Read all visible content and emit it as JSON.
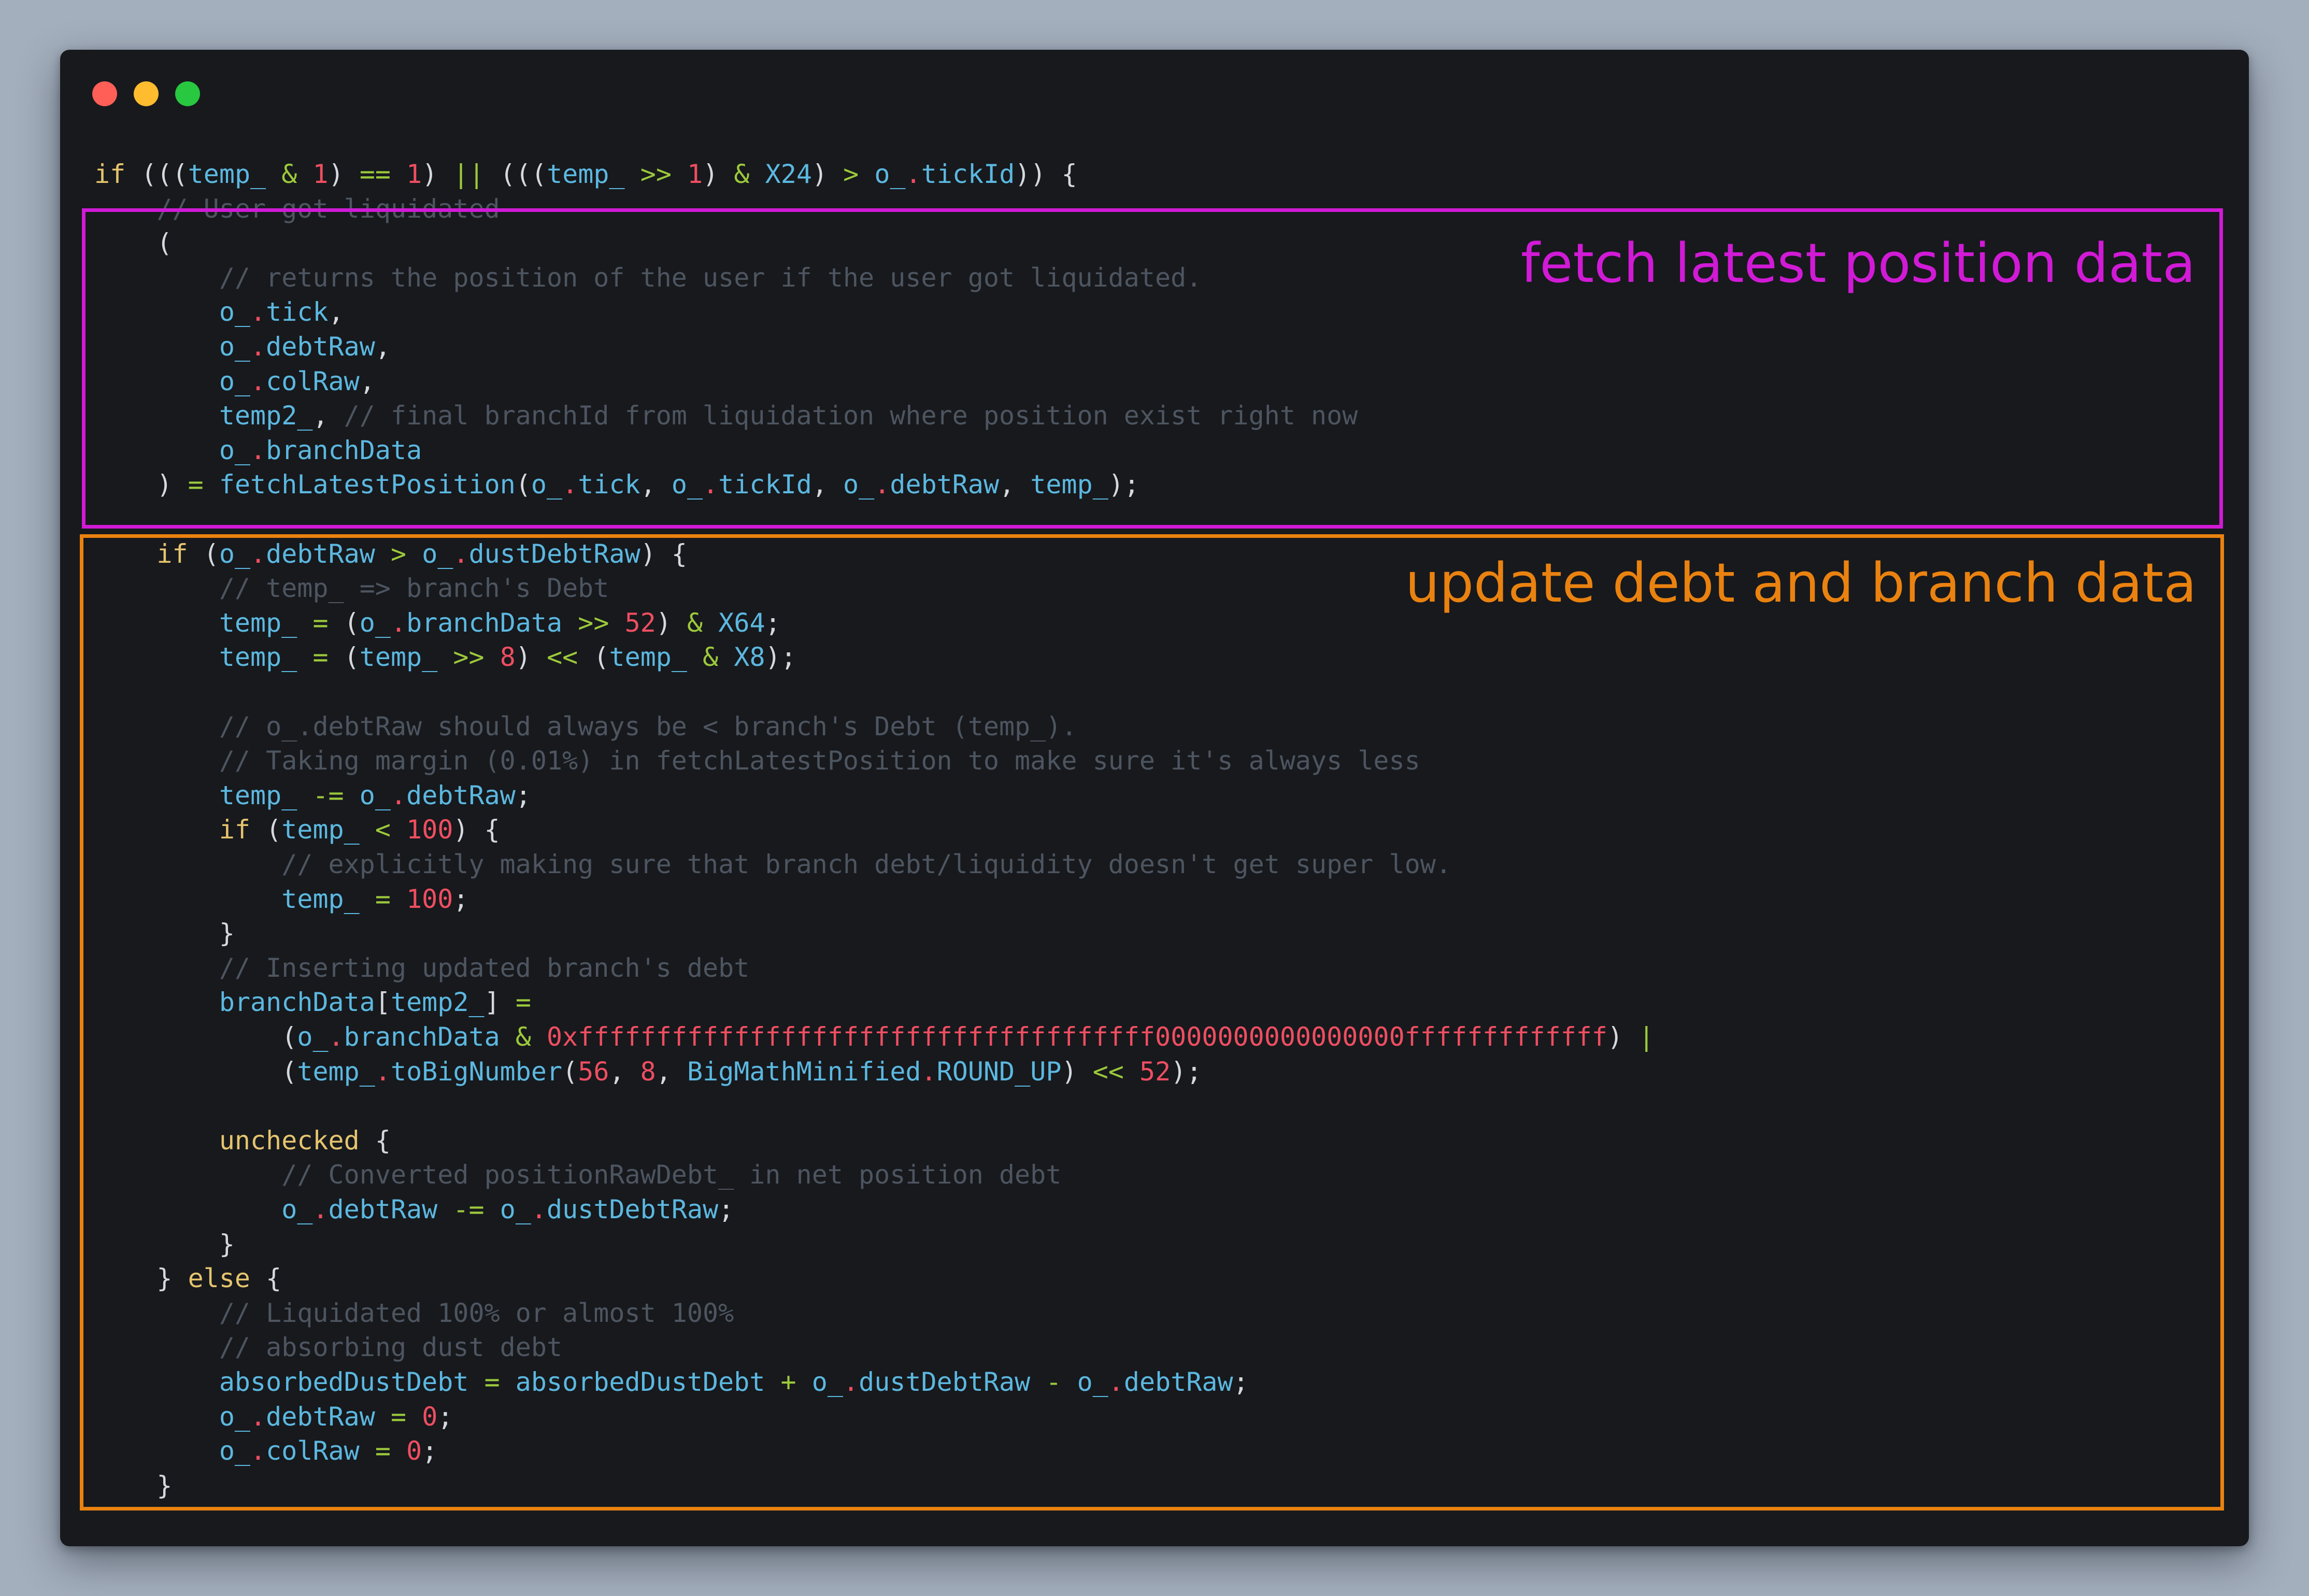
{
  "window": {
    "controls": {
      "close": "close-dot",
      "minimize": "minimize-dot",
      "zoom": "zoom-dot"
    }
  },
  "annotations": [
    {
      "label": "fetch latest position data",
      "color": "#d11ad6"
    },
    {
      "label": "update debt and branch data",
      "color": "#ea8210"
    }
  ],
  "colors": {
    "background": "#a4afbd",
    "editor": "#17191d",
    "keyword": "#e5c46e",
    "identifier": "#5cb8e0",
    "operator": "#9cc93b",
    "number": "#ef4e61",
    "comment": "#4d5560",
    "plain": "#d5d8dd"
  },
  "code": [
    [
      [
        "kw",
        "if"
      ],
      [
        "pl",
        " ((("
      ],
      [
        "id",
        "temp_"
      ],
      [
        "pl",
        " "
      ],
      [
        "op",
        "&"
      ],
      [
        "pl",
        " "
      ],
      [
        "num",
        "1"
      ],
      [
        "pl",
        ") "
      ],
      [
        "op",
        "=="
      ],
      [
        "pl",
        " "
      ],
      [
        "num",
        "1"
      ],
      [
        "pl",
        ") "
      ],
      [
        "op",
        "||"
      ],
      [
        "pl",
        " ((("
      ],
      [
        "id",
        "temp_"
      ],
      [
        "pl",
        " "
      ],
      [
        "op",
        ">>"
      ],
      [
        "pl",
        " "
      ],
      [
        "num",
        "1"
      ],
      [
        "pl",
        ") "
      ],
      [
        "op",
        "&"
      ],
      [
        "pl",
        " "
      ],
      [
        "id",
        "X24"
      ],
      [
        "pl",
        ") "
      ],
      [
        "op",
        ">"
      ],
      [
        "pl",
        " "
      ],
      [
        "id",
        "o_"
      ],
      [
        "dot",
        "."
      ],
      [
        "id",
        "tickId"
      ],
      [
        "pl",
        ")) {"
      ]
    ],
    [
      [
        "pl",
        "    "
      ],
      [
        "st",
        "// User got liquidated"
      ]
    ],
    [
      [
        "pl",
        "    ("
      ]
    ],
    [
      [
        "pl",
        "        "
      ],
      [
        "cm",
        "// returns the position of the user if the user got liquidated."
      ]
    ],
    [
      [
        "pl",
        "        "
      ],
      [
        "id",
        "o_"
      ],
      [
        "dot",
        "."
      ],
      [
        "id",
        "tick"
      ],
      [
        "pl",
        ","
      ]
    ],
    [
      [
        "pl",
        "        "
      ],
      [
        "id",
        "o_"
      ],
      [
        "dot",
        "."
      ],
      [
        "id",
        "debtRaw"
      ],
      [
        "pl",
        ","
      ]
    ],
    [
      [
        "pl",
        "        "
      ],
      [
        "id",
        "o_"
      ],
      [
        "dot",
        "."
      ],
      [
        "id",
        "colRaw"
      ],
      [
        "pl",
        ","
      ]
    ],
    [
      [
        "pl",
        "        "
      ],
      [
        "id",
        "temp2_"
      ],
      [
        "pl",
        ", "
      ],
      [
        "cm",
        "// final branchId from liquidation where position exist right now"
      ]
    ],
    [
      [
        "pl",
        "        "
      ],
      [
        "id",
        "o_"
      ],
      [
        "dot",
        "."
      ],
      [
        "id",
        "branchData"
      ]
    ],
    [
      [
        "pl",
        "    ) "
      ],
      [
        "op",
        "="
      ],
      [
        "pl",
        " "
      ],
      [
        "id",
        "fetchLatestPosition"
      ],
      [
        "pl",
        "("
      ],
      [
        "id",
        "o_"
      ],
      [
        "dot",
        "."
      ],
      [
        "id",
        "tick"
      ],
      [
        "pl",
        ", "
      ],
      [
        "id",
        "o_"
      ],
      [
        "dot",
        "."
      ],
      [
        "id",
        "tickId"
      ],
      [
        "pl",
        ", "
      ],
      [
        "id",
        "o_"
      ],
      [
        "dot",
        "."
      ],
      [
        "id",
        "debtRaw"
      ],
      [
        "pl",
        ", "
      ],
      [
        "id",
        "temp_"
      ],
      [
        "pl",
        ");"
      ]
    ],
    [
      [
        "pl",
        ""
      ]
    ],
    [
      [
        "pl",
        "    "
      ],
      [
        "kw",
        "if"
      ],
      [
        "pl",
        " ("
      ],
      [
        "id",
        "o_"
      ],
      [
        "dot",
        "."
      ],
      [
        "id",
        "debtRaw"
      ],
      [
        "pl",
        " "
      ],
      [
        "op",
        ">"
      ],
      [
        "pl",
        " "
      ],
      [
        "id",
        "o_"
      ],
      [
        "dot",
        "."
      ],
      [
        "id",
        "dustDebtRaw"
      ],
      [
        "pl",
        ") {"
      ]
    ],
    [
      [
        "pl",
        "        "
      ],
      [
        "cm",
        "// temp_ => branch's Debt"
      ]
    ],
    [
      [
        "pl",
        "        "
      ],
      [
        "id",
        "temp_"
      ],
      [
        "pl",
        " "
      ],
      [
        "op",
        "="
      ],
      [
        "pl",
        " ("
      ],
      [
        "id",
        "o_"
      ],
      [
        "dot",
        "."
      ],
      [
        "id",
        "branchData"
      ],
      [
        "pl",
        " "
      ],
      [
        "op",
        ">>"
      ],
      [
        "pl",
        " "
      ],
      [
        "num",
        "52"
      ],
      [
        "pl",
        ") "
      ],
      [
        "op",
        "&"
      ],
      [
        "pl",
        " "
      ],
      [
        "id",
        "X64"
      ],
      [
        "pl",
        ";"
      ]
    ],
    [
      [
        "pl",
        "        "
      ],
      [
        "id",
        "temp_"
      ],
      [
        "pl",
        " "
      ],
      [
        "op",
        "="
      ],
      [
        "pl",
        " ("
      ],
      [
        "id",
        "temp_"
      ],
      [
        "pl",
        " "
      ],
      [
        "op",
        ">>"
      ],
      [
        "pl",
        " "
      ],
      [
        "num",
        "8"
      ],
      [
        "pl",
        ") "
      ],
      [
        "op",
        "<<"
      ],
      [
        "pl",
        " ("
      ],
      [
        "id",
        "temp_"
      ],
      [
        "pl",
        " "
      ],
      [
        "op",
        "&"
      ],
      [
        "pl",
        " "
      ],
      [
        "id",
        "X8"
      ],
      [
        "pl",
        ");"
      ]
    ],
    [
      [
        "pl",
        ""
      ]
    ],
    [
      [
        "pl",
        "        "
      ],
      [
        "cm",
        "// o_.debtRaw should always be < branch's Debt (temp_)."
      ]
    ],
    [
      [
        "pl",
        "        "
      ],
      [
        "cm",
        "// Taking margin (0.01%) in fetchLatestPosition to make sure it's always less"
      ]
    ],
    [
      [
        "pl",
        "        "
      ],
      [
        "id",
        "temp_"
      ],
      [
        "pl",
        " "
      ],
      [
        "op",
        "-="
      ],
      [
        "pl",
        " "
      ],
      [
        "id",
        "o_"
      ],
      [
        "dot",
        "."
      ],
      [
        "id",
        "debtRaw"
      ],
      [
        "pl",
        ";"
      ]
    ],
    [
      [
        "pl",
        "        "
      ],
      [
        "kw",
        "if"
      ],
      [
        "pl",
        " ("
      ],
      [
        "id",
        "temp_"
      ],
      [
        "pl",
        " "
      ],
      [
        "op",
        "<"
      ],
      [
        "pl",
        " "
      ],
      [
        "num",
        "100"
      ],
      [
        "pl",
        ") {"
      ]
    ],
    [
      [
        "pl",
        "            "
      ],
      [
        "cm",
        "// explicitly making sure that branch debt/liquidity doesn't get super low."
      ]
    ],
    [
      [
        "pl",
        "            "
      ],
      [
        "id",
        "temp_"
      ],
      [
        "pl",
        " "
      ],
      [
        "op",
        "="
      ],
      [
        "pl",
        " "
      ],
      [
        "num",
        "100"
      ],
      [
        "pl",
        ";"
      ]
    ],
    [
      [
        "pl",
        "        }"
      ]
    ],
    [
      [
        "pl",
        "        "
      ],
      [
        "cm",
        "// Inserting updated branch's debt"
      ]
    ],
    [
      [
        "pl",
        "        "
      ],
      [
        "id",
        "branchData"
      ],
      [
        "pl",
        "["
      ],
      [
        "id",
        "temp2_"
      ],
      [
        "pl",
        "] "
      ],
      [
        "op",
        "="
      ]
    ],
    [
      [
        "pl",
        "            ("
      ],
      [
        "id",
        "o_"
      ],
      [
        "dot",
        "."
      ],
      [
        "id",
        "branchData"
      ],
      [
        "pl",
        " "
      ],
      [
        "op",
        "&"
      ],
      [
        "pl",
        " "
      ],
      [
        "num",
        "0xfffffffffffffffffffffffffffffffffffff0000000000000000fffffffffffff"
      ],
      [
        "pl",
        ") "
      ],
      [
        "op",
        "|"
      ]
    ],
    [
      [
        "pl",
        "            ("
      ],
      [
        "id",
        "temp_"
      ],
      [
        "dot",
        "."
      ],
      [
        "id",
        "toBigNumber"
      ],
      [
        "pl",
        "("
      ],
      [
        "num",
        "56"
      ],
      [
        "pl",
        ", "
      ],
      [
        "num",
        "8"
      ],
      [
        "pl",
        ", "
      ],
      [
        "id",
        "BigMathMinified"
      ],
      [
        "dot",
        "."
      ],
      [
        "id",
        "ROUND_UP"
      ],
      [
        "pl",
        ") "
      ],
      [
        "op",
        "<<"
      ],
      [
        "pl",
        " "
      ],
      [
        "num",
        "52"
      ],
      [
        "pl",
        ");"
      ]
    ],
    [
      [
        "pl",
        ""
      ]
    ],
    [
      [
        "pl",
        "        "
      ],
      [
        "kw",
        "unchecked"
      ],
      [
        "pl",
        " {"
      ]
    ],
    [
      [
        "pl",
        "            "
      ],
      [
        "cm",
        "// Converted positionRawDebt_ in net position debt"
      ]
    ],
    [
      [
        "pl",
        "            "
      ],
      [
        "id",
        "o_"
      ],
      [
        "dot",
        "."
      ],
      [
        "id",
        "debtRaw"
      ],
      [
        "pl",
        " "
      ],
      [
        "op",
        "-="
      ],
      [
        "pl",
        " "
      ],
      [
        "id",
        "o_"
      ],
      [
        "dot",
        "."
      ],
      [
        "id",
        "dustDebtRaw"
      ],
      [
        "pl",
        ";"
      ]
    ],
    [
      [
        "pl",
        "        }"
      ]
    ],
    [
      [
        "pl",
        "    } "
      ],
      [
        "kw",
        "else"
      ],
      [
        "pl",
        " {"
      ]
    ],
    [
      [
        "pl",
        "        "
      ],
      [
        "cm",
        "// Liquidated 100% or almost 100%"
      ]
    ],
    [
      [
        "pl",
        "        "
      ],
      [
        "cm",
        "// absorbing dust debt"
      ]
    ],
    [
      [
        "pl",
        "        "
      ],
      [
        "id",
        "absorbedDustDebt"
      ],
      [
        "pl",
        " "
      ],
      [
        "op",
        "="
      ],
      [
        "pl",
        " "
      ],
      [
        "id",
        "absorbedDustDebt"
      ],
      [
        "pl",
        " "
      ],
      [
        "op",
        "+"
      ],
      [
        "pl",
        " "
      ],
      [
        "id",
        "o_"
      ],
      [
        "dot",
        "."
      ],
      [
        "id",
        "dustDebtRaw"
      ],
      [
        "pl",
        " "
      ],
      [
        "op",
        "-"
      ],
      [
        "pl",
        " "
      ],
      [
        "id",
        "o_"
      ],
      [
        "dot",
        "."
      ],
      [
        "id",
        "debtRaw"
      ],
      [
        "pl",
        ";"
      ]
    ],
    [
      [
        "pl",
        "        "
      ],
      [
        "id",
        "o_"
      ],
      [
        "dot",
        "."
      ],
      [
        "id",
        "debtRaw"
      ],
      [
        "pl",
        " "
      ],
      [
        "op",
        "="
      ],
      [
        "pl",
        " "
      ],
      [
        "num",
        "0"
      ],
      [
        "pl",
        ";"
      ]
    ],
    [
      [
        "pl",
        "        "
      ],
      [
        "id",
        "o_"
      ],
      [
        "dot",
        "."
      ],
      [
        "id",
        "colRaw"
      ],
      [
        "pl",
        " "
      ],
      [
        "op",
        "="
      ],
      [
        "pl",
        " "
      ],
      [
        "num",
        "0"
      ],
      [
        "pl",
        ";"
      ]
    ],
    [
      [
        "pl",
        "    }"
      ]
    ]
  ]
}
